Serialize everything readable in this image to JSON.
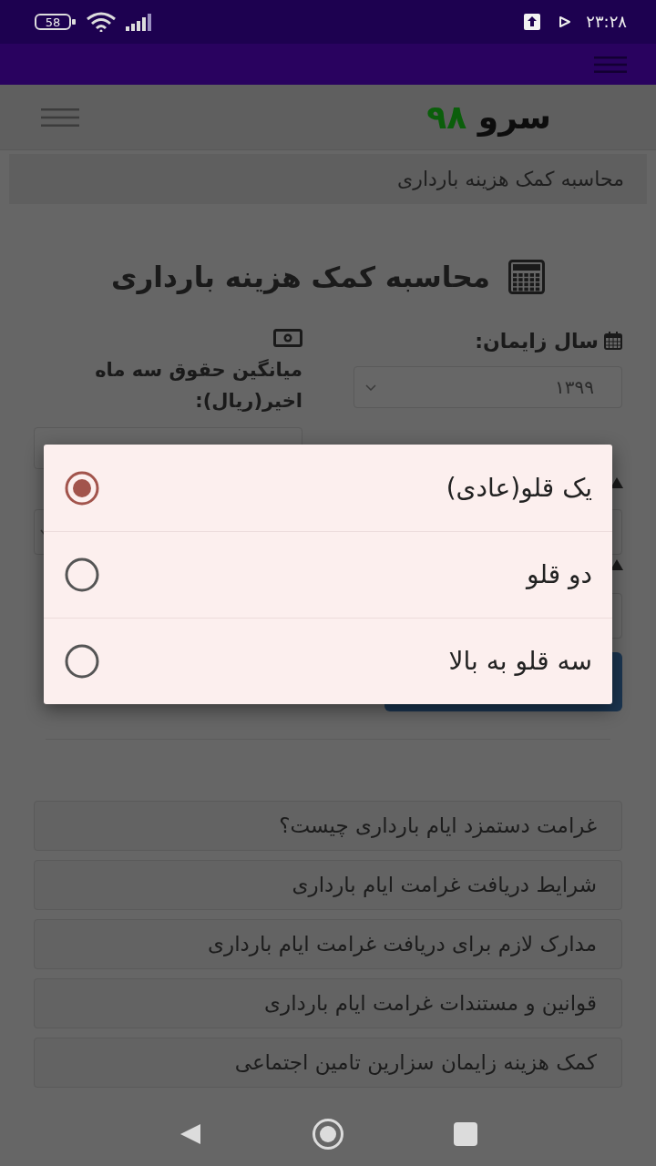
{
  "status_bar": {
    "battery": "58",
    "time": "۲۳:۲۸"
  },
  "header": {
    "logo_name": "سرو",
    "logo_number": "۹۸"
  },
  "breadcrumb": "محاسبه کمک هزینه بارداری",
  "heading": "محاسبه کمک هزینه بارداری",
  "form": {
    "birth_year": {
      "label": "سال زایمان:",
      "value": "۱۳۹۹"
    },
    "salary": {
      "label": "میانگین حقوق سه ماه اخیر(ریال):"
    }
  },
  "dialog": {
    "options": [
      {
        "label": "یک قلو(عادی)",
        "selected": true
      },
      {
        "label": "دو قلو",
        "selected": false
      },
      {
        "label": "سه قلو به بالا",
        "selected": false
      }
    ]
  },
  "links": [
    {
      "label": "غرامت دستمزد ایام بارداری چیست؟"
    },
    {
      "label": "شرایط دریافت غرامت ایام بارداری"
    },
    {
      "label": "مدارک لازم برای دریافت غرامت ایام بارداری"
    },
    {
      "label": "قوانین و مستندات غرامت ایام بارداری"
    },
    {
      "label": "کمک هزینه زایمان سزارین تامین اجتماعی"
    }
  ]
}
